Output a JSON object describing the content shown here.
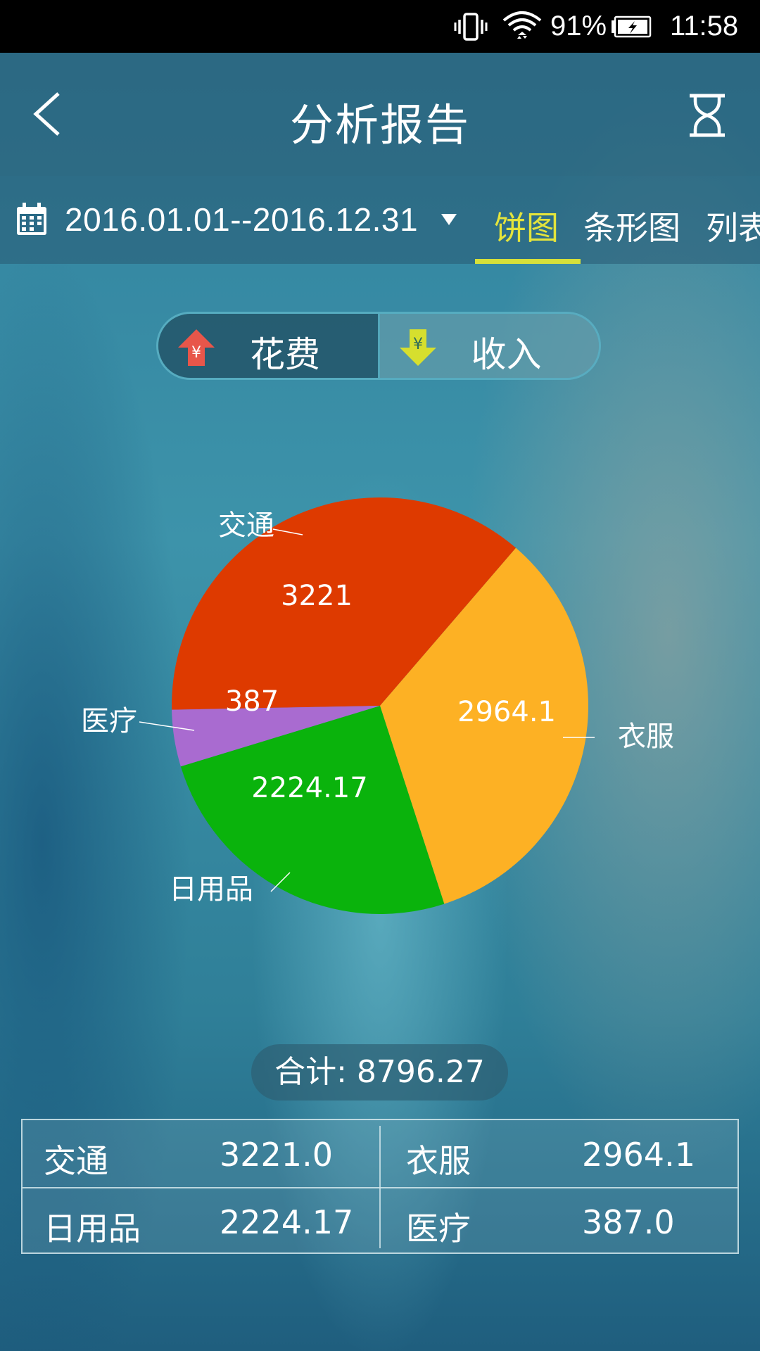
{
  "status_bar": {
    "battery": "91%",
    "time": "11:58",
    "icons": [
      "vibrate-icon",
      "wifi-icon",
      "battery-charging-icon"
    ]
  },
  "header": {
    "title": "分析报告",
    "back_icon": "back-chevron-icon",
    "right_icon": "hourglass-icon"
  },
  "filter": {
    "date_range": "2016.01.01--2016.12.31",
    "tabs": [
      {
        "label": "饼图",
        "active": true
      },
      {
        "label": "条形图",
        "active": false
      },
      {
        "label": "列表",
        "active": false
      }
    ]
  },
  "toggle": {
    "expense_label": "花费",
    "income_label": "收入",
    "selected": "expense",
    "expense_icon_color": "#e8564a",
    "income_icon_color": "#d6df2e"
  },
  "chart_data": {
    "type": "pie",
    "categories": [
      "交通",
      "衣服",
      "日用品",
      "医疗"
    ],
    "values": [
      3221,
      2964.1,
      2224.17,
      387
    ],
    "value_labels": [
      "3221",
      "2964.1",
      "2224.17",
      "387"
    ],
    "colors": [
      "#de3a00",
      "#fdb124",
      "#0ab30c",
      "#a96bd0"
    ]
  },
  "total": {
    "text": "合计: 8796.27"
  },
  "summary": {
    "rows": [
      [
        {
          "name": "交通",
          "value": "3221.0"
        },
        {
          "name": "衣服",
          "value": "2964.1"
        }
      ],
      [
        {
          "name": "日用品",
          "value": "2224.17"
        },
        {
          "name": "医疗",
          "value": "387.0"
        }
      ]
    ]
  }
}
